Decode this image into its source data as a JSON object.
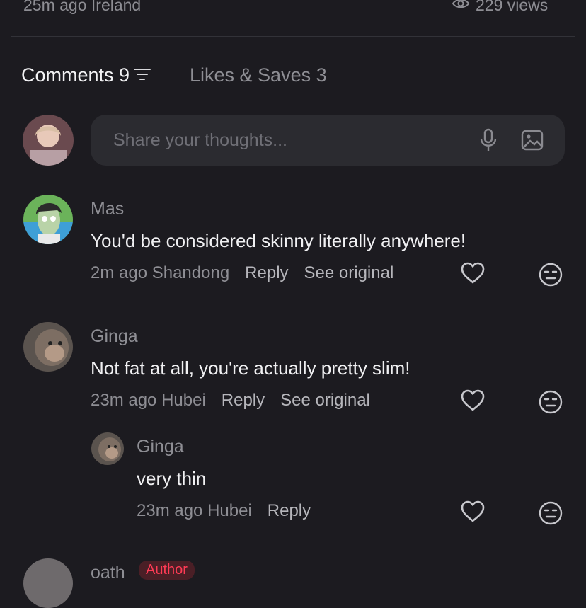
{
  "post_meta": {
    "time_location": "25m ago Ireland",
    "views": "229 views"
  },
  "tabs": {
    "comments_label": "Comments 9",
    "likes_saves_label": "Likes & Saves 3"
  },
  "input": {
    "placeholder": "Share your thoughts..."
  },
  "comments": [
    {
      "name": "Mas",
      "text": "You'd be considered skinny literally anywhere!",
      "time_location": "2m ago Shandong",
      "reply": "Reply",
      "see_original": "See original"
    },
    {
      "name": "Ginga",
      "text": "Not fat at all, you're actually pretty slim!",
      "time_location": "23m ago Hubei",
      "reply": "Reply",
      "see_original": "See original"
    },
    {
      "name": "Ginga",
      "text": "very thin",
      "time_location": "23m ago Hubei",
      "reply": "Reply"
    },
    {
      "name": "oath",
      "badge": "Author"
    }
  ],
  "colors": {
    "background": "#1c1b20",
    "input_bg": "#2b2b30",
    "muted": "#8e8e94",
    "author_badge": "#ff3b55"
  }
}
